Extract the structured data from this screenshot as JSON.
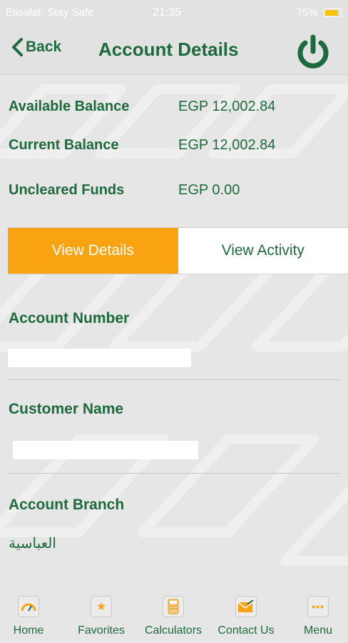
{
  "status_bar": {
    "carrier": "Etisalat- Stay Safe",
    "time": "21:35",
    "battery": "75%"
  },
  "nav": {
    "back_label": "Back",
    "title": "Account Details"
  },
  "balances": [
    {
      "label": "Available Balance",
      "value": "EGP 12,002.84"
    },
    {
      "label": "Current Balance",
      "value": "EGP 12,002.84"
    },
    {
      "label": "Uncleared Funds",
      "value": "EGP 0.00"
    }
  ],
  "tabs": {
    "details": "View Details",
    "activity": "View Activity"
  },
  "fields": {
    "account_number_label": "Account Number",
    "customer_name_label": "Customer Name",
    "account_branch_label": "Account Branch",
    "account_branch_value": "العباسية"
  },
  "bottom_tabs": [
    {
      "label": "Home",
      "icon": "speedometer-icon"
    },
    {
      "label": "Favorites",
      "icon": "star-icon"
    },
    {
      "label": "Calculators",
      "icon": "calculator-icon"
    },
    {
      "label": "Contact Us",
      "icon": "envelope-icon"
    },
    {
      "label": "Menu",
      "icon": "more-icon"
    }
  ],
  "colors": {
    "brand_green": "#1d6a3c",
    "accent_orange": "#f9a312",
    "background": "#e6e6e6"
  }
}
